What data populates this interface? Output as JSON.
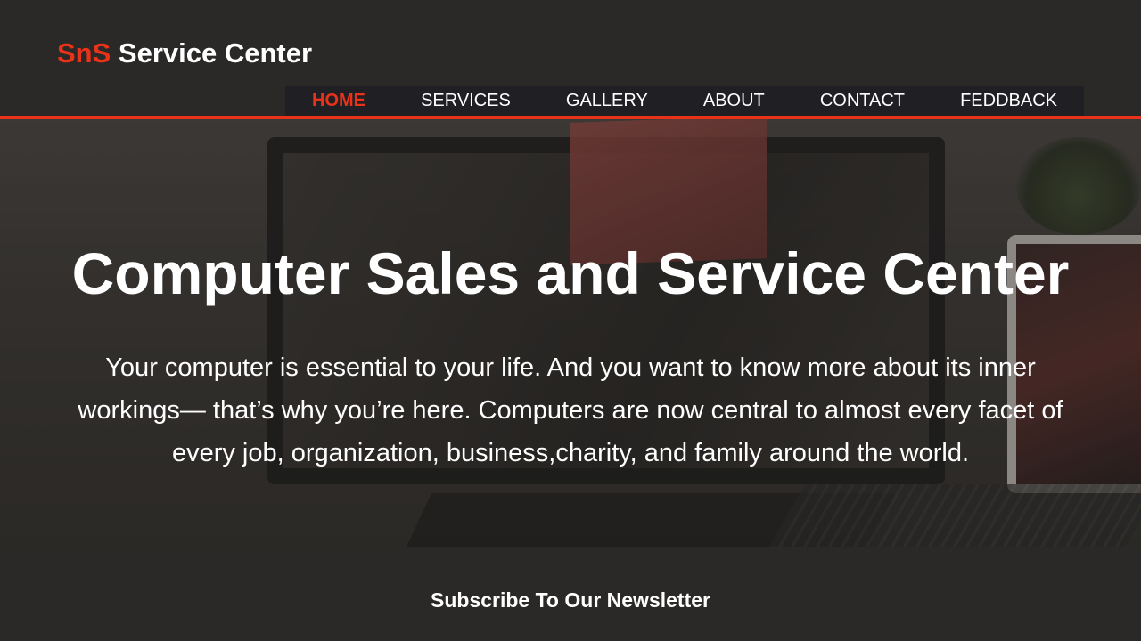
{
  "header": {
    "logo_brand": "SnS",
    "logo_rest": "Service Center"
  },
  "nav": {
    "items": [
      {
        "label": "HOME",
        "active": true
      },
      {
        "label": "SERVICES",
        "active": false
      },
      {
        "label": "GALLERY",
        "active": false
      },
      {
        "label": "ABOUT",
        "active": false
      },
      {
        "label": "CONTACT",
        "active": false
      },
      {
        "label": "FEDDBACK",
        "active": false
      }
    ]
  },
  "hero": {
    "title": "Computer Sales and Service Center",
    "text": "Your computer is essential to your life. And you want to know more about its inner workings— that’s why you’re here. Computers are now central to almost every facet of every job, organization, business,charity, and family around the world."
  },
  "newsletter": {
    "title": "Subscribe To Our Newsletter"
  },
  "colors": {
    "accent": "#e8321a",
    "background": "#2a2927",
    "nav_background": "#1f1f24",
    "text": "#ffffff"
  }
}
